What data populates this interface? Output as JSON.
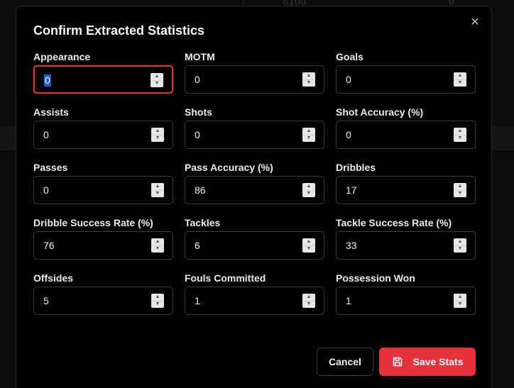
{
  "background": {
    "numbers": [
      "8100",
      "0"
    ]
  },
  "dialog": {
    "title": "Confirm Extracted Statistics",
    "close_icon": "close-icon",
    "fields": [
      {
        "label": "Appearance",
        "value": "0",
        "focused": true
      },
      {
        "label": "MOTM",
        "value": "0"
      },
      {
        "label": "Goals",
        "value": "0"
      },
      {
        "label": "Assists",
        "value": "0"
      },
      {
        "label": "Shots",
        "value": "0"
      },
      {
        "label": "Shot Accuracy (%)",
        "value": "0"
      },
      {
        "label": "Passes",
        "value": "0"
      },
      {
        "label": "Pass Accuracy (%)",
        "value": "86"
      },
      {
        "label": "Dribbles",
        "value": "17"
      },
      {
        "label": "Dribble Success Rate (%)",
        "value": "76"
      },
      {
        "label": "Tackles",
        "value": "6"
      },
      {
        "label": "Tackle Success Rate (%)",
        "value": "33"
      },
      {
        "label": "Offsides",
        "value": "5"
      },
      {
        "label": "Fouls Committed",
        "value": "1"
      },
      {
        "label": "Possession Won",
        "value": "1"
      }
    ],
    "cancel_label": "Cancel",
    "save_label": "Save Stats",
    "save_icon": "save-icon"
  },
  "colors": {
    "accent": "#e5323b",
    "focus_ring": "#d93a2f",
    "selection": "#1f5fd6"
  }
}
